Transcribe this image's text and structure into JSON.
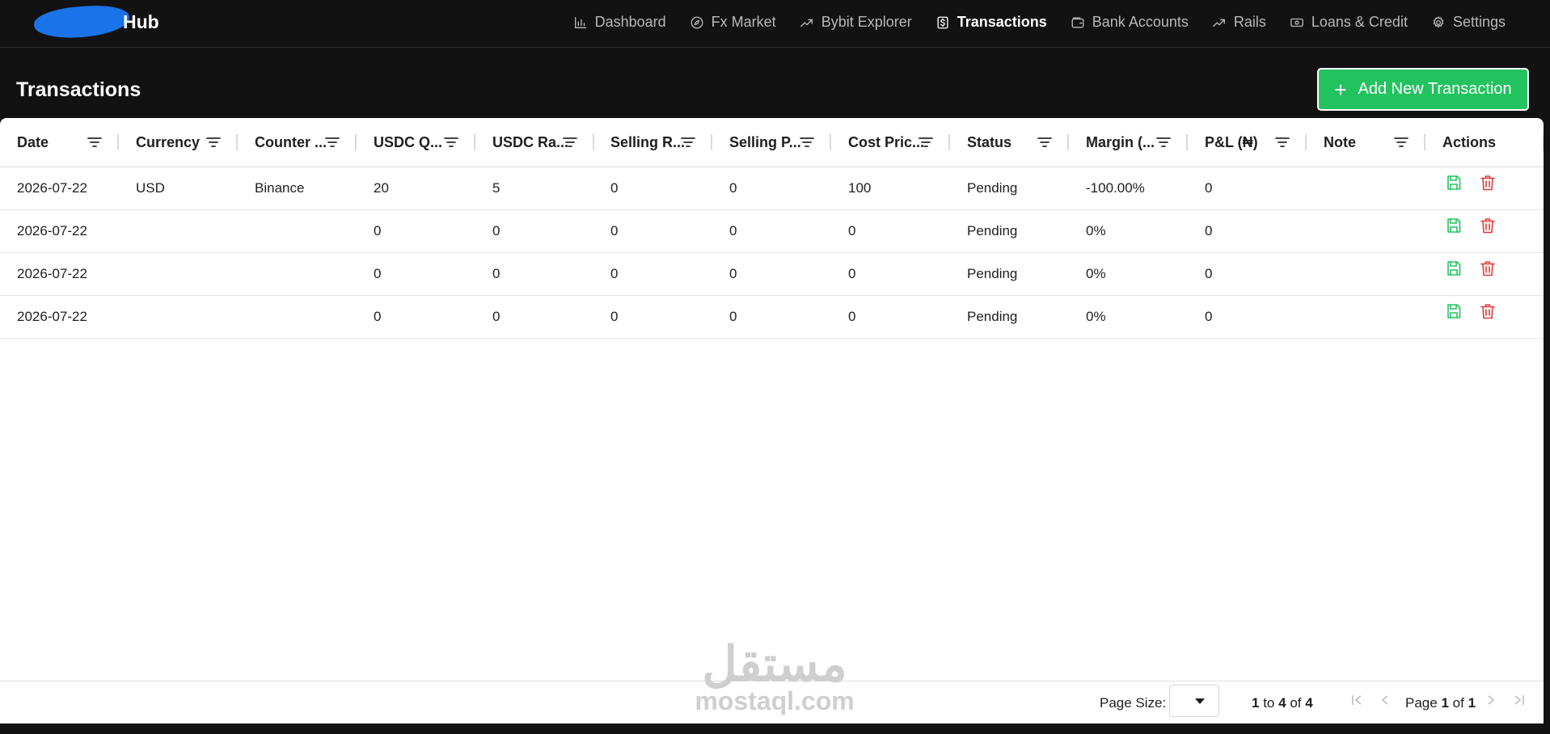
{
  "app": {
    "logo_text": "Hub"
  },
  "nav": [
    {
      "label": "Dashboard",
      "icon": "bar-chart-icon",
      "active": false
    },
    {
      "label": "Fx Market",
      "icon": "compass-icon",
      "active": false
    },
    {
      "label": "Bybit Explorer",
      "icon": "trending-up-icon",
      "active": false
    },
    {
      "label": "Transactions",
      "icon": "dollar-file-icon",
      "active": true
    },
    {
      "label": "Bank Accounts",
      "icon": "wallet-icon",
      "active": false
    },
    {
      "label": "Rails",
      "icon": "trending-up-icon",
      "active": false
    },
    {
      "label": "Loans & Credit",
      "icon": "banknote-icon",
      "active": false
    },
    {
      "label": "Settings",
      "icon": "gear-icon",
      "active": false
    }
  ],
  "page": {
    "title": "Transactions",
    "add_button_label": "Add New Transaction",
    "add_button_icon": "plus-icon"
  },
  "table": {
    "columns": [
      "Date",
      "Currency",
      "Counter ...",
      "USDC Q...",
      "USDC Ra...",
      "Selling R...",
      "Selling P...",
      "Cost Pric...",
      "Status",
      "Margin (...",
      "P&L (₦)",
      "Note",
      "Actions"
    ],
    "rows": [
      [
        "2026-07-22",
        "USD",
        "Binance",
        "20",
        "5",
        "0",
        "0",
        "100",
        "Pending",
        "-100.00%",
        "0",
        ""
      ],
      [
        "2026-07-22",
        "",
        "",
        "0",
        "0",
        "0",
        "0",
        "0",
        "Pending",
        "0%",
        "0",
        ""
      ],
      [
        "2026-07-22",
        "",
        "",
        "0",
        "0",
        "0",
        "0",
        "0",
        "Pending",
        "0%",
        "0",
        ""
      ],
      [
        "2026-07-22",
        "",
        "",
        "0",
        "0",
        "0",
        "0",
        "0",
        "Pending",
        "0%",
        "0",
        ""
      ]
    ],
    "row_actions": {
      "save_icon": "save-icon",
      "delete_icon": "trash-icon",
      "save_color": "#22c35e",
      "delete_color": "#e53935"
    }
  },
  "pagination": {
    "page_size_label": "Page Size:",
    "page_size_value": "",
    "range_from": "1",
    "range_to_word": "to",
    "range_to": "4",
    "range_of_word": "of",
    "range_total": "4",
    "page_word": "Page",
    "page_current": "1",
    "page_of_word": "of",
    "page_total": "1"
  },
  "watermark": {
    "arabic": "مستقل",
    "latin": "mostaql.com"
  },
  "colors": {
    "accent": "#22c35e",
    "danger": "#e53935",
    "nav_bg": "#121212",
    "logo_blob": "#1a73e8"
  }
}
